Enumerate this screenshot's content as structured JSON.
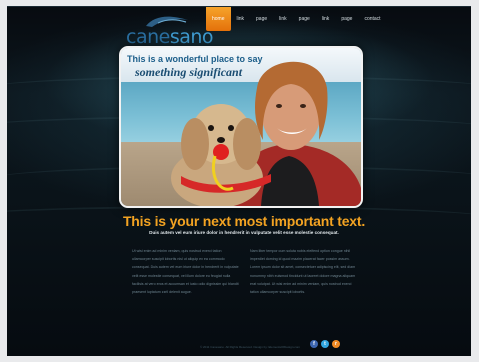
{
  "logo": {
    "part1": "cane",
    "part2": "sano"
  },
  "nav": [
    {
      "label": "home",
      "active": true
    },
    {
      "label": "link",
      "active": false
    },
    {
      "label": "page",
      "active": false
    },
    {
      "label": "link",
      "active": false
    },
    {
      "label": "page",
      "active": false
    },
    {
      "label": "link",
      "active": false
    },
    {
      "label": "page",
      "active": false
    },
    {
      "label": "contact",
      "active": false
    }
  ],
  "hero": {
    "tagline1": "This is a wonderful place to say",
    "tagline2": "something significant"
  },
  "content": {
    "headline": "This is your next most important text.",
    "subheadline": "Duis autem vel eum iriure dolor in hendrerit in vulputate velit esse molestie consequat.",
    "col_left": "Ut wisi enim ad minim veniam, quis nostrud exerci tation ullamcorper suscipit lobortis nisl ut aliquip ex ea commodo consequat. Duis autem vel eum iriure dolor in hendrerit in vulputate velit esse molestie consequat, vel illum dolore eu feugiat nulla facilisis at vero eros et accumsan et iusto odio dignissim qui blandit praesent luptatum zzril delenit augue.",
    "col_right": "Nam liber tempor cum soluta nobis eleifend option congue nihil imperdiet doming id quod mazim placerat facer possim assum. Lorem ipsum dolor sit amet, consectetuer adipiscing elit, sed diam nonummy nibh euismod tincidunt ut laoreet dolore magna aliquam erat volutpat. Ut wisi enim ad minim veniam, quis nostrud exerci tation ullamcorper suscipit lobortis."
  },
  "footer": {
    "text": "© 2011 Canesano. All Rights Reserved. Design by: ElementsOfDesign.com"
  },
  "social": [
    "f",
    "t",
    "r"
  ],
  "colors": {
    "accent": "#f3a322",
    "nav_active": "#e4710a",
    "logo_blue": "#2a6fa1"
  }
}
